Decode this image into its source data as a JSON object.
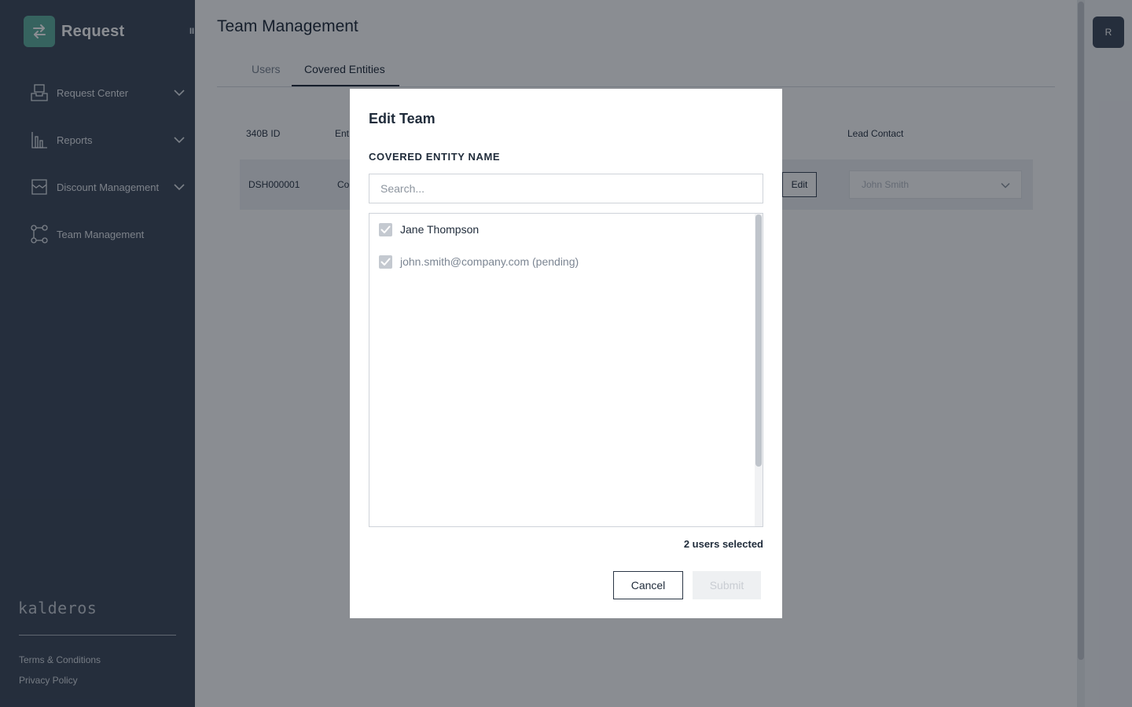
{
  "sidebar": {
    "brand": "Request",
    "brand_icon": "swap-arrows-icon",
    "collapse_glyph": "II",
    "items": [
      {
        "label": "Request Center",
        "icon": "inbox-tray-icon",
        "has_chevron": true
      },
      {
        "label": "Reports",
        "icon": "bar-chart-icon",
        "has_chevron": true
      },
      {
        "label": "Discount Management",
        "icon": "discount-box-icon",
        "has_chevron": true
      },
      {
        "label": "Team Management",
        "icon": "team-nodes-icon",
        "has_chevron": false
      }
    ],
    "wordmark": "kalderos",
    "footer_links": [
      "Terms & Conditions",
      "Privacy Policy"
    ]
  },
  "header": {
    "title": "Team Management",
    "avatar_initial": "R"
  },
  "tabs": [
    {
      "label": "Users",
      "active": false
    },
    {
      "label": "Covered Entities",
      "active": true
    }
  ],
  "table": {
    "headers": [
      "340B ID",
      "Ent",
      "Lead Contact"
    ],
    "row": {
      "id": "DSH000001",
      "entity_partial": "Co",
      "edit_label": "Edit",
      "lead_contact": "John Smith"
    }
  },
  "modal": {
    "title": "Edit Team",
    "section_label": "COVERED ENTITY NAME",
    "search_placeholder": "Search...",
    "users": [
      {
        "label": "Jane Thompson",
        "checked": true,
        "pending": false
      },
      {
        "label": "john.smith@company.com (pending)",
        "checked": true,
        "pending": true
      }
    ],
    "selected_count": "2 users selected",
    "cancel_label": "Cancel",
    "submit_label": "Submit"
  },
  "colors": {
    "sidebar_bg": "#3e4a5b",
    "brand_accent": "#5fae9e",
    "text_dark": "#1f2b3a",
    "overlay": "rgba(10,16,28,0.48)"
  }
}
